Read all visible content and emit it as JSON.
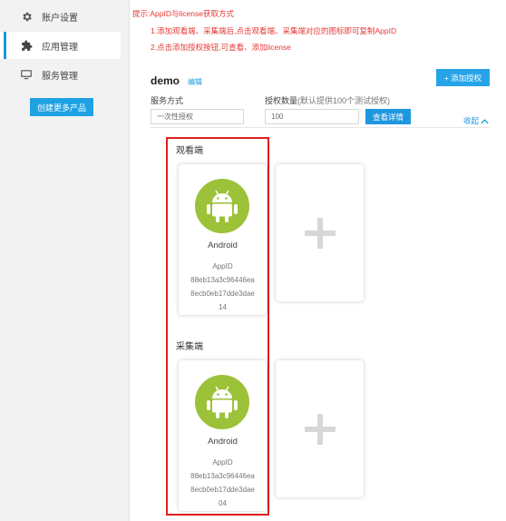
{
  "sidebar": {
    "items": [
      {
        "label": "账户设置",
        "icon": "gear-icon"
      },
      {
        "label": "应用管理",
        "icon": "puzzle-icon"
      },
      {
        "label": "服务管理",
        "icon": "monitor-icon"
      }
    ],
    "create_button": "创建更多产品"
  },
  "tips": {
    "title": "提示:AppID与license获取方式",
    "line1": "1.添加观看端、采集端后,点击观看端、采集端对应的图标即可复制AppID",
    "line2": "2.点击添加授权按钮,可查看、添加license"
  },
  "project": {
    "name": "demo",
    "edit_label": "编辑",
    "add_auth_button": "+ 添加授权",
    "service_mode_label": "服务方式",
    "service_mode_value": "一次性授权",
    "auth_count_label": "授权数量",
    "auth_count_note": "(默认提供100个测试授权)",
    "auth_count_value": "100",
    "view_details_button": "查看详情",
    "collapse_label": "收起"
  },
  "sections": [
    {
      "title": "观看端",
      "platform": "Android",
      "appid_label": "AppID",
      "appid_lines": [
        "88eb13a3c96446ea",
        "8ecb0eb17dde3dae",
        "14"
      ]
    },
    {
      "title": "采集端",
      "platform": "Android",
      "appid_label": "AppID",
      "appid_lines": [
        "88eb13a3c96446ea",
        "8ecb0eb17dde3dae",
        "04"
      ]
    }
  ],
  "colors": {
    "accent": "#1fa2e4",
    "android_green": "#9bc238",
    "tip_red": "#e53935",
    "highlight_frame": "#e01e1e"
  }
}
